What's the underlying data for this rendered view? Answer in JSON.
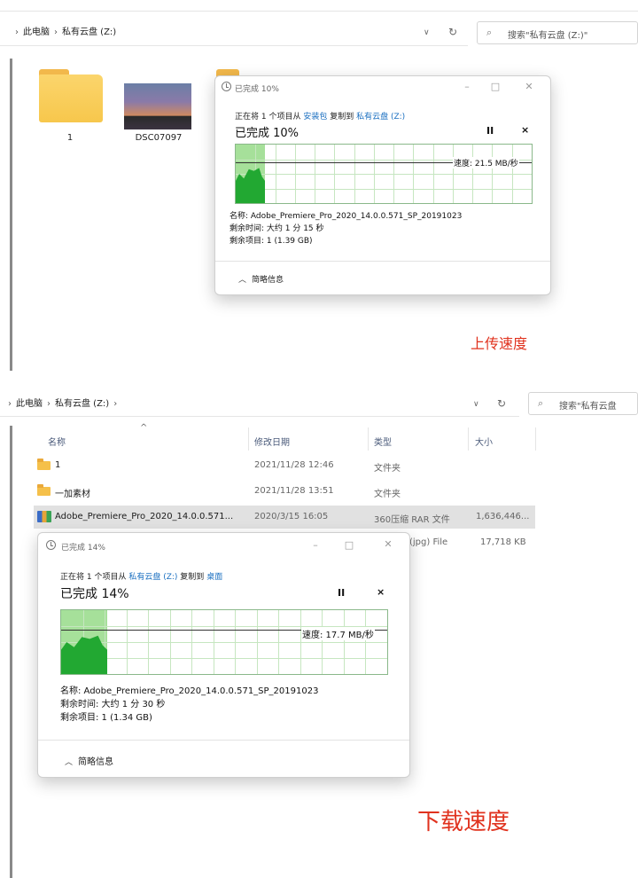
{
  "upload": {
    "breadcrumb": [
      "此电脑",
      "私有云盘 (Z:)"
    ],
    "search_placeholder": "搜索\"私有云盘 (Z:)\"",
    "items": [
      {
        "label": "1"
      },
      {
        "label": "DSC07097"
      }
    ],
    "dialog": {
      "title": "已完成 10%",
      "copy_prefix": "正在将 1 个项目从",
      "source": "安装包",
      "copy_mid": "复制到",
      "destination": "私有云盘 (Z:)",
      "progress_label": "已完成 10%",
      "progress": 0.1,
      "speed": "速度: 21.5 MB/秒",
      "name": "名称: Adobe_Premiere_Pro_2020_14.0.0.571_SP_20191023",
      "time_remaining": "剩余时间: 大约 1 分 15 秒",
      "items_remaining": "剩余项目: 1 (1.39 GB)",
      "less_details": "简略信息",
      "pause_glyph": "II",
      "cancel_glyph": "×"
    },
    "annotation": "上传速度"
  },
  "download": {
    "breadcrumb": [
      "此电脑",
      "私有云盘 (Z:)"
    ],
    "search_placeholder": "搜索\"私有云盘",
    "columns": [
      "名称",
      "修改日期",
      "类型",
      "大小"
    ],
    "rows": [
      {
        "name": "1",
        "date": "2021/11/28 12:46",
        "type": "文件夹",
        "size": ""
      },
      {
        "name": "一加素材",
        "date": "2021/11/28 13:51",
        "type": "文件夹",
        "size": ""
      },
      {
        "name": "Adobe_Premiere_Pro_2020_14.0.0.571...",
        "date": "2020/3/15 16:05",
        "type": "360压缩 RAR 文件",
        "size": "1,636,446..."
      },
      {
        "name": "",
        "date": "",
        "type": "(jpg) File",
        "size": "17,718 KB"
      }
    ],
    "dialog": {
      "title": "已完成 14%",
      "copy_prefix": "正在将 1 个项目从",
      "source": "私有云盘 (Z:)",
      "copy_mid": "复制到",
      "destination": "桌面",
      "progress_label": "已完成 14%",
      "progress": 0.14,
      "speed": "速度: 17.7 MB/秒",
      "name": "名称: Adobe_Premiere_Pro_2020_14.0.0.571_SP_20191023",
      "time_remaining": "剩余时间: 大约 1 分 30 秒",
      "items_remaining": "剩余项目: 1 (1.34 GB)",
      "less_details": "简略信息",
      "pause_glyph": "II",
      "cancel_glyph": "×"
    },
    "annotation": "下载速度"
  },
  "colors": {
    "accent_link": "#1a6fc0",
    "annotation": "#e0321e",
    "graph_fill": "#22a832",
    "graph_done": "#a6e09a"
  },
  "icons": [
    "folder-icon",
    "image-thumbnail-icon",
    "clock-icon",
    "pause-icon",
    "close-icon",
    "chevron-up-icon",
    "search-icon",
    "refresh-icon",
    "rar-archive-icon"
  ]
}
